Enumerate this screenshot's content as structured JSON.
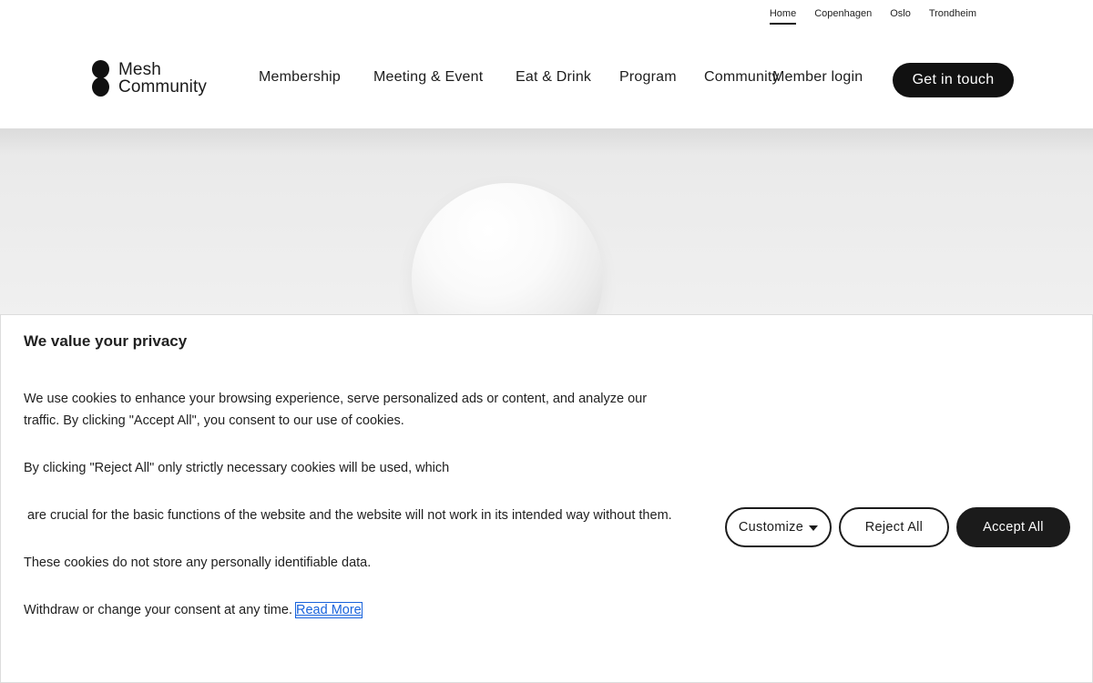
{
  "top_nav": {
    "items": [
      {
        "label": "Home",
        "active": true
      },
      {
        "label": "Copenhagen"
      },
      {
        "label": "Oslo"
      },
      {
        "label": "Trondheim"
      }
    ]
  },
  "header": {
    "logo": {
      "line1": "Mesh",
      "line2": "Community"
    },
    "nav": [
      {
        "label": "Membership"
      },
      {
        "label": "Meeting & Event"
      },
      {
        "label": "Eat & Drink"
      },
      {
        "label": "Program"
      },
      {
        "label": "Community"
      },
      {
        "label": "Member login"
      }
    ],
    "cta_label": "Get in touch"
  },
  "cookie_banner": {
    "title": "We value your privacy",
    "paragraphs": [
      "We use cookies to enhance your browsing experience, serve personalized ads or content, and analyze our traffic. By clicking \"Accept All\", you consent to our use of cookies.",
      "By clicking \"Reject All\" only strictly necessary cookies will be used, which",
      " are crucial for the basic functions of the website and the website will not work in its intended way without them.",
      "These cookies do not store any personally identifiable data."
    ],
    "last_paragraph": "Withdraw or change your consent at any time.",
    "read_more": "Read More",
    "buttons": {
      "customize": "Customize",
      "reject": "Reject All",
      "accept": "Accept All"
    }
  },
  "colors": {
    "primary_dark": "#111111",
    "link": "#1863dc",
    "hero_bg": "#f1f1f1"
  }
}
